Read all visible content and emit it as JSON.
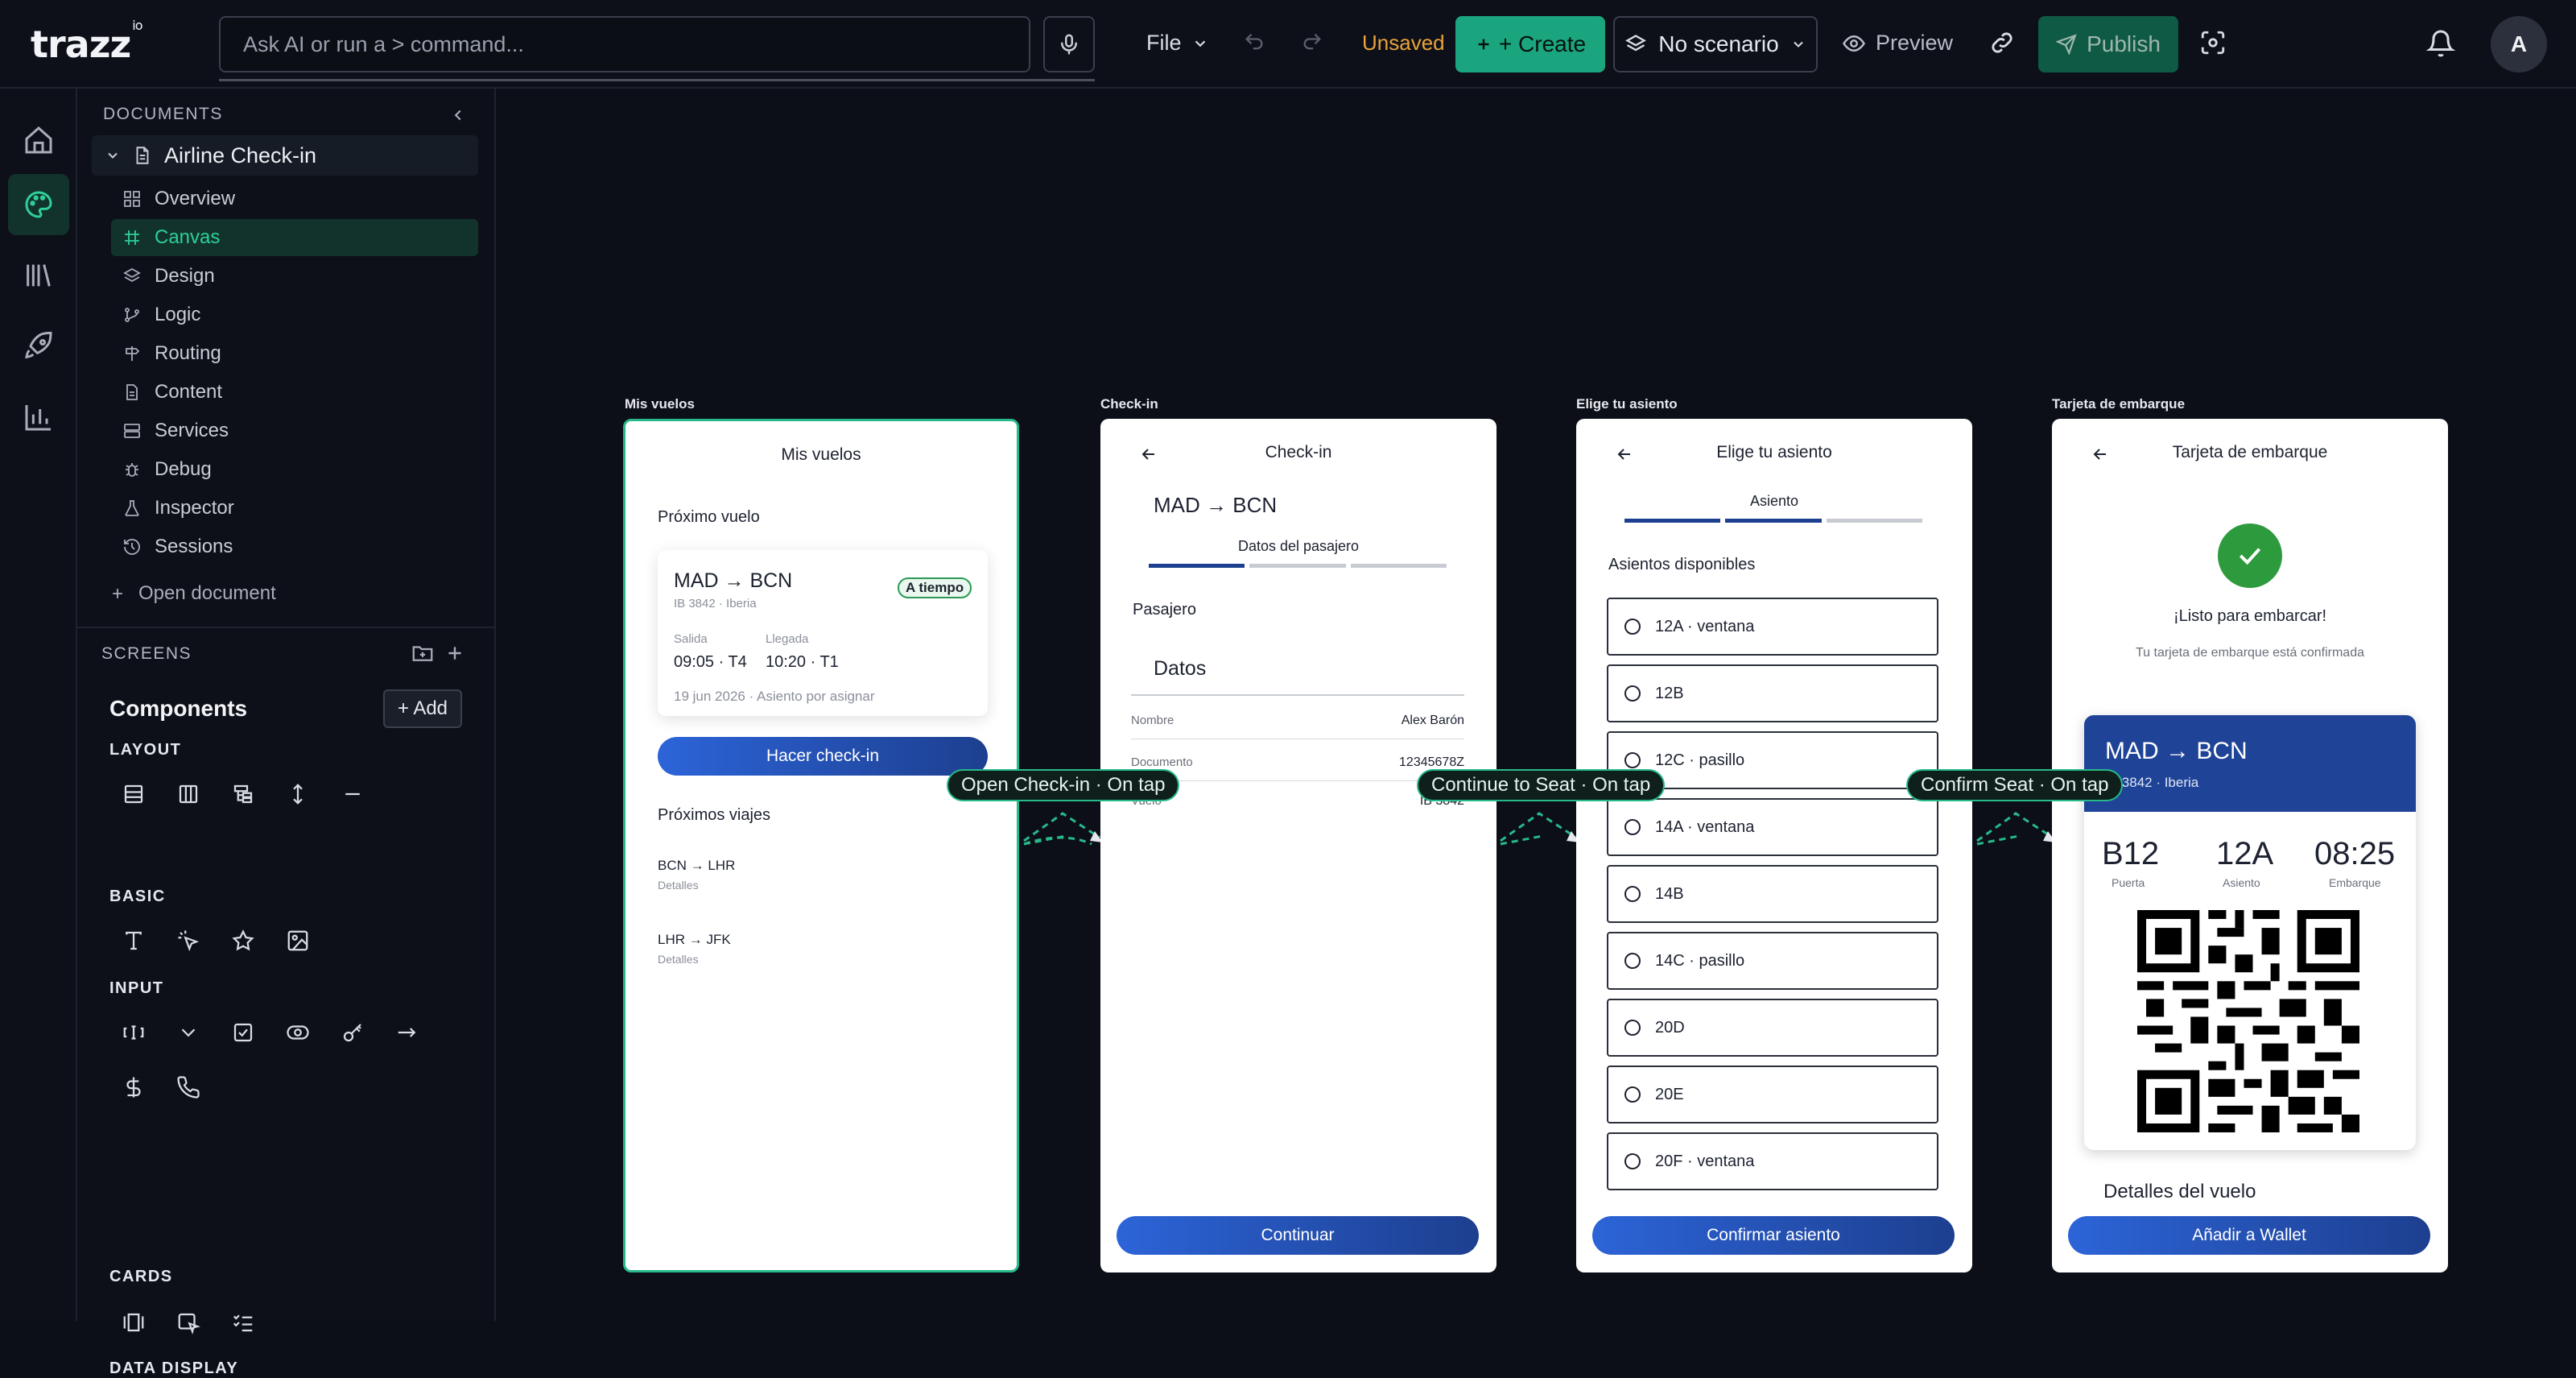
{
  "app": {
    "logo": "trazz",
    "logo_sup": "io"
  },
  "topbar": {
    "command_placeholder": "Ask AI or run a > command...",
    "file_label": "File",
    "status": "Unsaved",
    "create_label": "+ Create",
    "scenario_label": "No scenario",
    "preview_label": "Preview",
    "publish_label": "Publish",
    "avatar": "A",
    "colors": {
      "accent": "#1ba57e",
      "unsaved": "#e8a23a"
    }
  },
  "sidebar": {
    "documents_header": "DOCUMENTS",
    "document": "Airline Check-in",
    "nav": [
      "Overview",
      "Canvas",
      "Design",
      "Logic",
      "Routing",
      "Content",
      "Services",
      "Debug",
      "Inspector",
      "Sessions"
    ],
    "active_nav": "Canvas",
    "open_document": "Open document",
    "screens_header": "SCREENS",
    "components_title": "Components",
    "add_label": "+ Add",
    "categories": {
      "layout": "LAYOUT",
      "basic": "BASIC",
      "input": "INPUT",
      "cards": "CARDS",
      "data_display": "DATA DISPLAY"
    }
  },
  "canvas": {
    "frames": [
      {
        "label": "Mis vuelos",
        "title": "Mis vuelos",
        "next_flight_label": "Próximo vuelo",
        "route": "MAD → BCN",
        "flight_meta": "IB 3842 · Iberia",
        "status_badge": "A tiempo",
        "dep_label": "Salida",
        "dep_value": "09:05 · T4",
        "arr_label": "Llegada",
        "arr_value": "10:20 · T1",
        "date_line": "19 jun 2026 · Asiento por asignar",
        "checkin_btn": "Hacer check-in",
        "upcoming_label": "Próximos viajes",
        "trips": [
          {
            "route": "BCN → LHR",
            "sub": "Detalles"
          },
          {
            "route": "LHR → JFK",
            "sub": "Detalles"
          }
        ]
      },
      {
        "label": "Check-in",
        "title": "Check-in",
        "route": "MAD → BCN",
        "step_label": "Datos del pasajero",
        "section": "Pasajero",
        "subheading": "Datos",
        "fields": [
          {
            "label": "Nombre",
            "value": "Alex Barón"
          },
          {
            "label": "Documento",
            "value": "12345678Z"
          },
          {
            "label": "Vuelo",
            "value": "IB 3842"
          }
        ],
        "button": "Continuar"
      },
      {
        "label": "Elige tu asiento",
        "title": "Elige tu asiento",
        "step_label": "Asiento",
        "section": "Asientos disponibles",
        "seats": [
          "12A · ventana",
          "12B",
          "12C · pasillo",
          "14A · ventana",
          "14B",
          "14C · pasillo",
          "20D",
          "20E",
          "20F · ventana"
        ],
        "button": "Confirmar asiento"
      },
      {
        "label": "Tarjeta de embarque",
        "title": "Tarjeta de embarque",
        "ready": "¡Listo para embarcar!",
        "confirmed": "Tu tarjeta de embarque está confirmada",
        "route": "MAD → BCN",
        "flight_meta": "IB 3842 · Iberia",
        "gate_value": "B12",
        "gate_label": "Puerta",
        "seat_value": "12A",
        "seat_label": "Asiento",
        "board_value": "08:25",
        "board_label": "Embarque",
        "details": "Detalles del vuelo",
        "button": "Añadir a Wallet"
      }
    ],
    "connectors": [
      "Open Check-in · On tap",
      "Continue to Seat · On tap",
      "Confirm Seat · On tap"
    ]
  }
}
